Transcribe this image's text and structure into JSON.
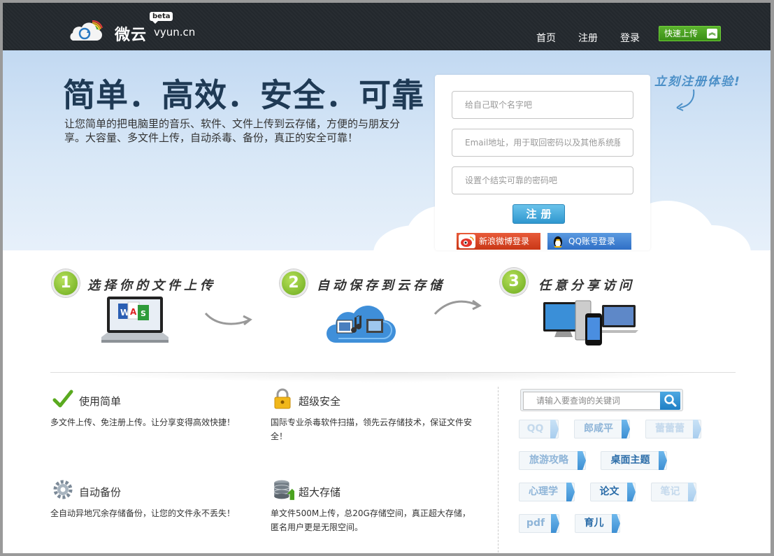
{
  "header": {
    "logo_cn": "微云",
    "logo_en": "vyun.cn",
    "logo_badge": "beta",
    "nav": {
      "home": "首页",
      "register": "注册",
      "login": "登录"
    },
    "quick_upload": "快速上传"
  },
  "hero": {
    "title": "简单．高效．安全．可靠",
    "description": "让您简单的把电脑里的音乐、软件、文件上传到云存储，方便的与朋友分享。大容量、多文件上传，自动杀毒、备份，真正的安全可靠！",
    "try_now": "立刻注册体验!"
  },
  "register": {
    "name_placeholder": "给自己取个名字吧",
    "email_placeholder": "Email地址，用于取回密码以及其他系统服务",
    "password_placeholder": "设置个结实可靠的密码吧",
    "submit_label": "注册",
    "sina_login": "新浪微博登录",
    "qq_login": "QQ账号登录"
  },
  "steps": [
    {
      "number": "1",
      "label": "选择你的文件上传"
    },
    {
      "number": "2",
      "label": "自动保存到云存储"
    },
    {
      "number": "3",
      "label": "任意分享访问"
    }
  ],
  "features": [
    {
      "title": "使用简单",
      "desc": "多文件上传、免注册上传。让分享变得高效快捷！",
      "icon": "checkmark-icon"
    },
    {
      "title": "超级安全",
      "desc": "国际专业杀毒软件扫描，领先云存储技术，保证文件安全！",
      "icon": "lock-icon"
    },
    {
      "title": "自动备份",
      "desc": "全自动异地冗余存储备份，让您的文件永不丢失！",
      "icon": "gear-icon"
    },
    {
      "title": "超大存储",
      "desc": "单文件500M上传，总20G存储空间，真正超大存储，匿名用户更是无限空间。",
      "icon": "database-icon"
    }
  ],
  "search": {
    "placeholder": "请输入要查询的关键词"
  },
  "tags": [
    "QQ",
    "郎咸平",
    "蕾蕾蕾",
    "旅游攻略",
    "桌面主题",
    "心理学",
    "论文",
    "笔记",
    "pdf",
    "育儿"
  ],
  "colors": {
    "header_bg": "#23282d",
    "accent_green": "#4aa21f",
    "accent_blue": "#2f97cf",
    "title": "#1f3a55"
  }
}
